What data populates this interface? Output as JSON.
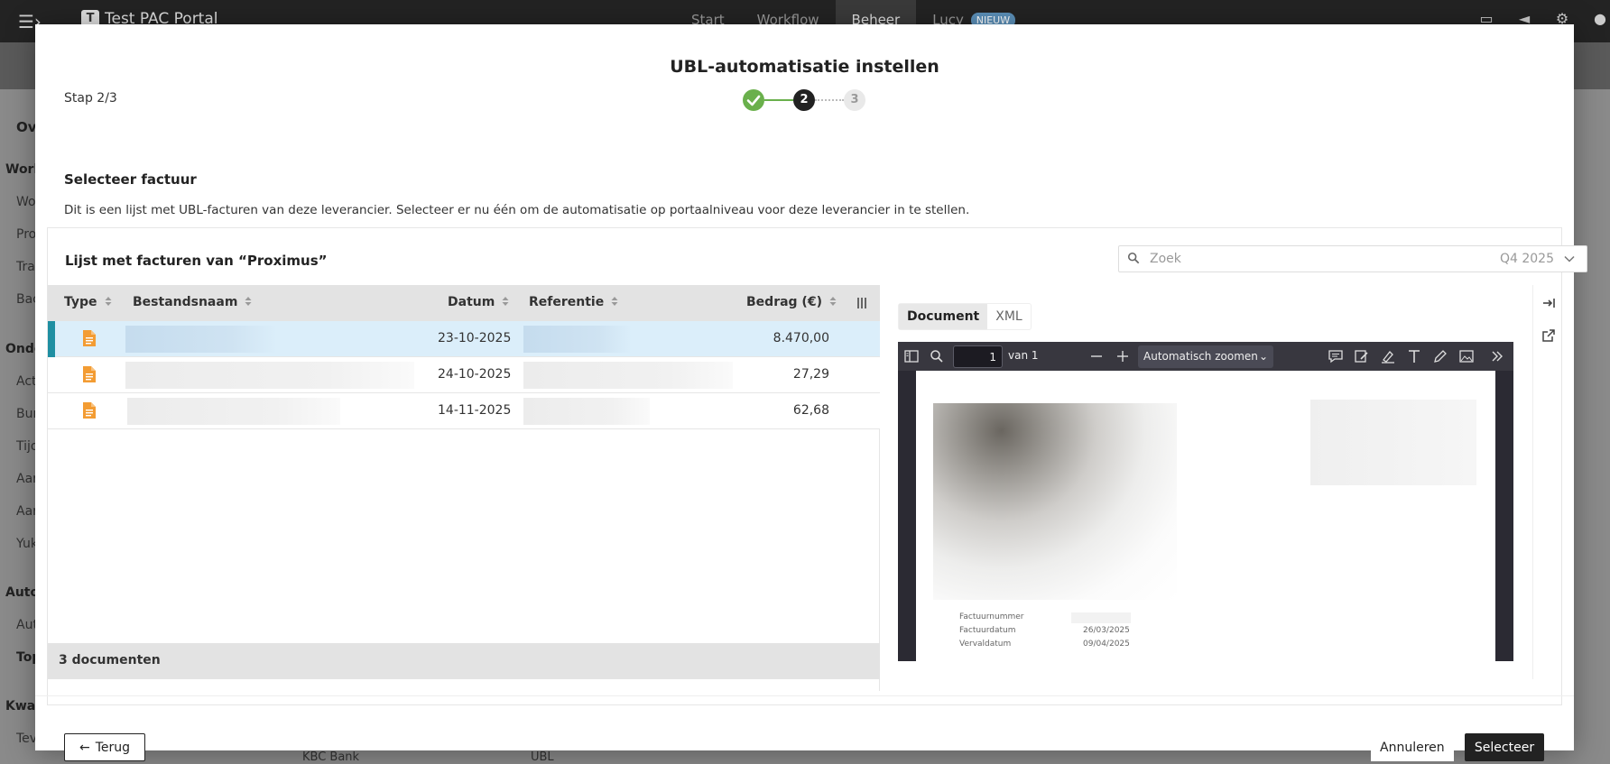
{
  "app": {
    "title": "Test PAC Portal",
    "logo_letter": "T",
    "nav": [
      {
        "label": "Start"
      },
      {
        "label": "Workflow"
      },
      {
        "label": "Beheer"
      },
      {
        "label": "Lucy",
        "badge": "NIEUW"
      }
    ]
  },
  "background_sidebar": {
    "items": [
      "Ov",
      "Work",
      "Wo",
      "Pro",
      "Tra",
      "Bac",
      "Onde",
      "Act",
      "Bur",
      "Tijo",
      "Aar",
      "Aar",
      "Yuk",
      "Auto",
      "Aut",
      "Top",
      "Kwal",
      "Tev"
    ]
  },
  "background_table": {
    "row_name": "KBC Bank",
    "row_type": "UBL"
  },
  "modal": {
    "title": "UBL-automatisatie instellen",
    "step_label": "Stap 2/3",
    "steps": [
      "",
      "2",
      "3"
    ],
    "section_title": "Selecteer factuur",
    "section_description": "Dit is een lijst met UBL-facturen van deze leverancier. Selecteer er nu één om de automatisatie op portaalniveau voor deze leverancier in te stellen."
  },
  "panel": {
    "title": "Lijst met facturen van “Proximus”",
    "search_placeholder": "Zoek",
    "period": "Q4 2025"
  },
  "table": {
    "columns": {
      "type": "Type",
      "filename": "Bestandsnaam",
      "date": "Datum",
      "reference": "Referentie",
      "amount": "Bedrag (€)"
    },
    "rows": [
      {
        "date": "23-10-2025",
        "amount": "8.470,00",
        "selected": true
      },
      {
        "date": "24-10-2025",
        "amount": "27,29",
        "selected": false
      },
      {
        "date": "14-11-2025",
        "amount": "62,68",
        "selected": false
      }
    ],
    "footer_count": "3 documenten"
  },
  "preview": {
    "tabs": [
      "Document",
      "XML"
    ],
    "active_tab": "Document",
    "page_number": "1",
    "page_total": "van 1",
    "zoom": "Automatisch zoomen",
    "invoice_fields": [
      {
        "label": "Factuurnummer",
        "value": ""
      },
      {
        "label": "Factuurdatum",
        "value": "26/03/2025"
      },
      {
        "label": "Vervaldatum",
        "value": "09/04/2025"
      }
    ]
  },
  "footer": {
    "back": "Terug",
    "cancel": "Annuleren",
    "select": "Selecteer"
  },
  "colors": {
    "accent_selected_row": "#dbeefa",
    "selected_marker": "#1f8fa2",
    "step_done": "#6ab04c",
    "primary_button": "#222222",
    "file_icon": "#f39c33"
  }
}
